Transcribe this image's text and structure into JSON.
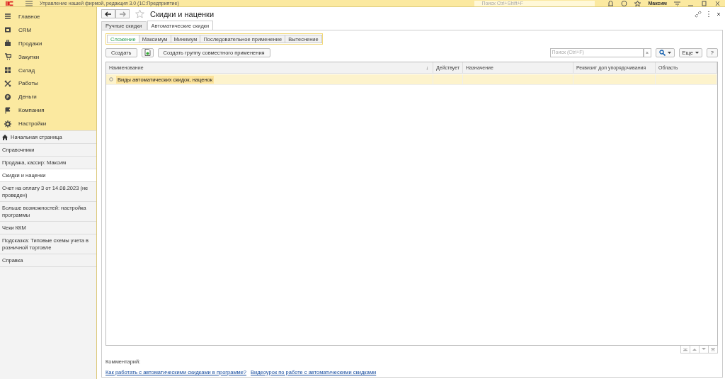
{
  "app_bar": {
    "title": "Управление нашей фирмой, редакция 3.0  (1С:Предприятие)",
    "search_placeholder": "Поиск Ctrl+Shift+F",
    "user": "Максим"
  },
  "sidebar": {
    "sections": [
      {
        "label": "Главное",
        "kind": "menu"
      },
      {
        "label": "CRM",
        "kind": "crm"
      },
      {
        "label": "Продажи",
        "kind": "case"
      },
      {
        "label": "Закупки",
        "kind": "cart"
      },
      {
        "label": "Склад",
        "kind": "grid"
      },
      {
        "label": "Работы",
        "kind": "tools"
      },
      {
        "label": "Деньги",
        "kind": "coin"
      },
      {
        "label": "Компания",
        "kind": "flag"
      },
      {
        "label": "Настройки",
        "kind": "gear"
      }
    ],
    "open_windows": [
      {
        "label": "Начальная страница",
        "home": true,
        "selected": false
      },
      {
        "label": "Справочники",
        "home": false,
        "selected": false
      },
      {
        "label": "Продажа, кассир: Максим",
        "home": false,
        "selected": false
      },
      {
        "label": "Скидки и наценки",
        "home": false,
        "selected": true
      },
      {
        "label": "Счет на оплату 3 от 14.08.2023 (не проведен)",
        "home": false,
        "selected": false
      },
      {
        "label": "Больше возможностей: настройка программы",
        "home": false,
        "selected": false
      },
      {
        "label": "Чеки ККМ",
        "home": false,
        "selected": false
      },
      {
        "label": "Подсказка: Типовые схемы учета в розничной торговле",
        "home": false,
        "selected": false
      },
      {
        "label": "Справка",
        "home": false,
        "selected": false
      }
    ]
  },
  "form": {
    "title": "Скидки и наценки",
    "tabs": [
      {
        "label": "Ручные скидки",
        "selected": false
      },
      {
        "label": "Автоматические скидки",
        "selected": true
      }
    ],
    "modes": [
      {
        "label": "Сложение",
        "selected": true
      },
      {
        "label": "Максимум",
        "selected": false
      },
      {
        "label": "Минимум",
        "selected": false
      },
      {
        "label": "Последовательное применение",
        "selected": false
      },
      {
        "label": "Вытеснение",
        "selected": false
      }
    ],
    "create_button": "Создать",
    "group_button": "Создать группу совместного применения",
    "search_placeholder": "Поиск (Ctrl+F)",
    "clear": "×",
    "more_button": "Еще",
    "help_button": "?",
    "table": {
      "columns": [
        {
          "label": "Наименование",
          "sort": "↓"
        },
        {
          "label": "Действует"
        },
        {
          "label": "Назначение"
        },
        {
          "label": "Реквизит доп упорядочивания"
        },
        {
          "label": "Область"
        }
      ],
      "rows": [
        {
          "cells": [
            "Виды автоматических скидок, наценок",
            "",
            "",
            "",
            ""
          ],
          "selected": true
        }
      ]
    },
    "comment_label": "Комментарий:",
    "links": [
      "Как работать с автоматическими скидками в программе?",
      "Видеоурок по работе с автоматическими скидками"
    ]
  }
}
